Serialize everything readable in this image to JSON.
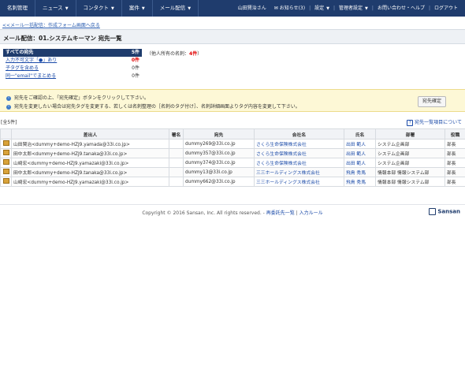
{
  "nav": {
    "items": [
      {
        "label": "名刺管理",
        "caret": false
      },
      {
        "label": "ニュース",
        "caret": true
      },
      {
        "label": "コンタクト",
        "caret": true
      },
      {
        "label": "案件",
        "caret": true
      },
      {
        "label": "メール配信",
        "caret": true
      }
    ],
    "user": "山田賢治さん",
    "notice": "お知らせ(3)",
    "settings": "設定",
    "admin": "管理者設定",
    "help": "お問い合わせ・ヘルプ",
    "logout": "ログアウト"
  },
  "breadcrumb": "<<メール一括配信：作成フォーム画面へ戻る",
  "page_title": "メール配信：01.システムキーマン 宛先一覧",
  "filters": [
    {
      "label": "すべての宛先",
      "count": "5件",
      "selected": true,
      "red": false
    },
    {
      "label": "入力不可文字「●」あり",
      "count": "0件",
      "selected": false,
      "red": true
    },
    {
      "label": "子タグを含める",
      "count": "0件",
      "selected": false,
      "red": false
    },
    {
      "label": "同一\"email\"でまとめる",
      "count": "0件",
      "selected": false,
      "red": false
    }
  ],
  "owned": {
    "prefix": "（他人所有の名刺：",
    "value": "4件",
    "suffix": "）"
  },
  "notice": {
    "line1": "宛先をご確認の上、「宛先確定」ボタンをクリックして下さい。",
    "line2": "宛先を変更したい場合は宛先タグを変更する、若しくは名刺整理の［名刺のタグ付け］、名刺詳細画面よりタグ内容を変更して下さい。",
    "button": "宛先確定"
  },
  "count_label": "[全5件]",
  "help_link": "宛先一覧項目について",
  "table": {
    "headers": [
      "差出人",
      "署名",
      "宛先",
      "会社名",
      "氏名",
      "部署",
      "役職"
    ],
    "rows": [
      {
        "sender": "山田賢治<dummy+demo-HZJ9.yamada@33i.co.jp>",
        "sign": "",
        "to": "dummy269@33i.co.jp",
        "company": "さくら生命保険株式会社",
        "name": "出田 範人",
        "dept": "システム企画部",
        "title": "部長"
      },
      {
        "sender": "田中太郎<dummy+demo-HZJ9.tanaka@33i.co.jp>",
        "sign": "",
        "to": "dummy357@33i.co.jp",
        "company": "さくら生命保険株式会社",
        "name": "出田 範人",
        "dept": "システム企画部",
        "title": "部長"
      },
      {
        "sender": "山崎宏<dummy+demo-HZJ9.yamazaki@33i.co.jp>",
        "sign": "",
        "to": "dummy374@33i.co.jp",
        "company": "さくら生命保険株式会社",
        "name": "出田 範人",
        "dept": "システム企画部",
        "title": "部長"
      },
      {
        "sender": "田中太郎<dummy+demo-HZJ9.tanaka@33i.co.jp>",
        "sign": "",
        "to": "dummy13@33i.co.jp",
        "company": "三三ホールディングス株式会社",
        "name": "飛鳥 秀馬",
        "dept": "情報本部 情報システム部",
        "title": "部長"
      },
      {
        "sender": "山崎宏<dummy+demo-HZJ9.yamazaki@33i.co.jp>",
        "sign": "",
        "to": "dummy662@33i.co.jp",
        "company": "三三ホールディングス株式会社",
        "name": "飛鳥 秀馬",
        "dept": "情報本部 情報システム部",
        "title": "部長"
      }
    ]
  },
  "footer": {
    "copyright": "Copyright © 2016 Sansan, Inc. All rights reserved. -",
    "link1": "再委託先一覧",
    "sep": "|",
    "link2": "入力ルール",
    "brand": "Sansan"
  }
}
